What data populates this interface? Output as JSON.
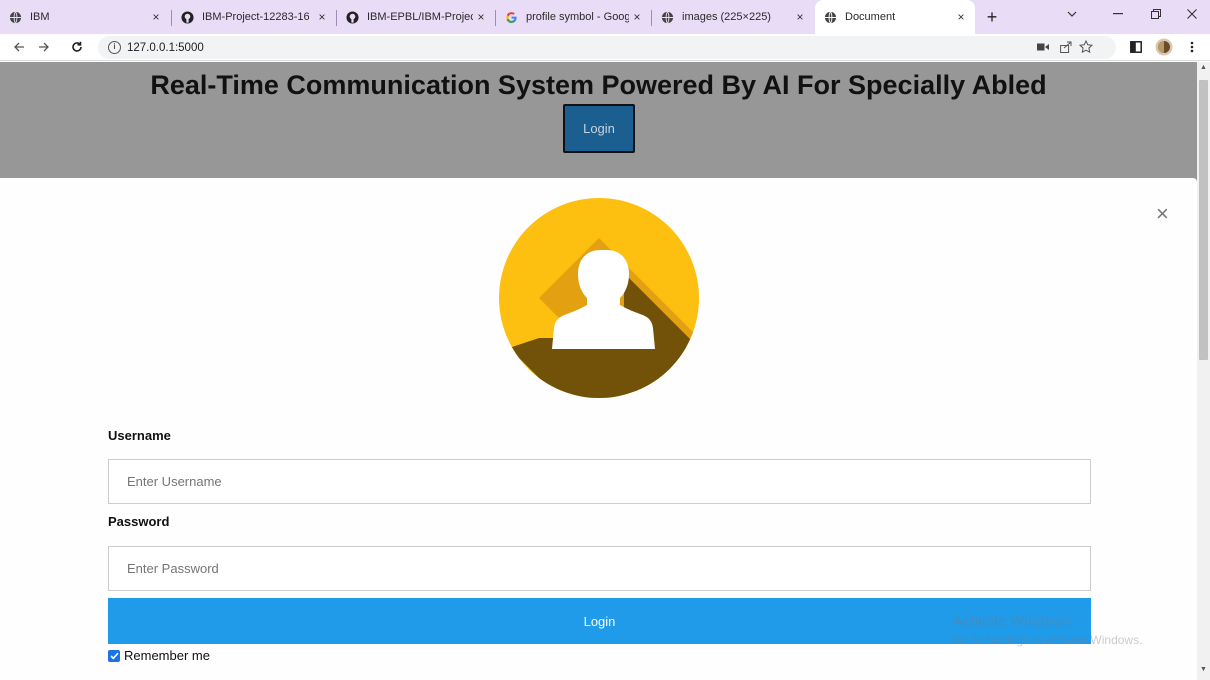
{
  "browser": {
    "tabs": [
      {
        "title": "IBM",
        "icon": "globe-icon"
      },
      {
        "title": "IBM-Project-12283-16",
        "icon": "github-icon"
      },
      {
        "title": "IBM-EPBL/IBM-Project",
        "icon": "github-icon"
      },
      {
        "title": "profile symbol - Goog",
        "icon": "google-icon"
      },
      {
        "title": "images (225×225)",
        "icon": "globe-icon"
      },
      {
        "title": "Document",
        "icon": "globe-icon",
        "active": true
      }
    ],
    "close_glyph": "×",
    "new_tab_glyph": "+",
    "url": "127.0.0.1:5000"
  },
  "page": {
    "title": "Real-Time Communication System Powered By AI For Specially Abled",
    "header_login_label": "Login"
  },
  "modal": {
    "close_glyph": "×",
    "username_label": "Username",
    "username_placeholder": "Enter Username",
    "password_label": "Password",
    "password_placeholder": "Enter Password",
    "submit_label": "Login",
    "remember_label": "Remember me",
    "remember_checked": true
  },
  "watermark": {
    "line1": "Activate Windows",
    "line2": "Go to Settings to activate Windows."
  },
  "colors": {
    "header_bg": "#979797",
    "submit_bg": "#1f9bea",
    "header_login_bg": "#1a5f8f",
    "tabstrip_bg": "#e9dcf7",
    "avatar_yellow": "#fdc010",
    "avatar_shadow": "#725108"
  }
}
